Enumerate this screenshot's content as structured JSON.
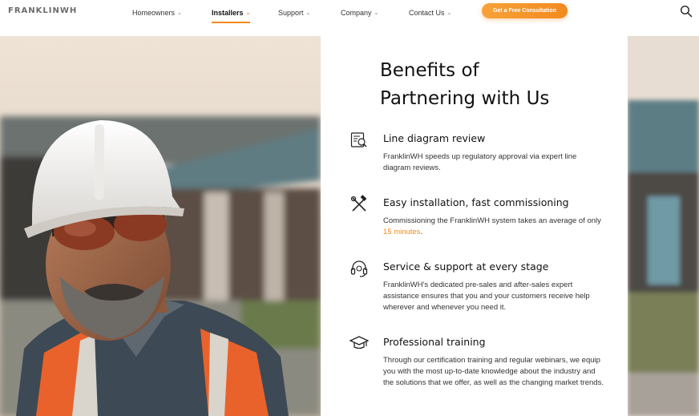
{
  "brand": {
    "logo_text": "FRANKLINWH",
    "accent": "#f08a1c"
  },
  "nav": {
    "items": [
      {
        "label": "Homeowners",
        "active": false
      },
      {
        "label": "Installers",
        "active": true
      },
      {
        "label": "Support",
        "active": false
      },
      {
        "label": "Company",
        "active": false
      },
      {
        "label": "Contact Us",
        "active": false
      }
    ],
    "cta_label": "Get a Free Consultation",
    "search_icon": "search-icon"
  },
  "section": {
    "heading_line1": "Benefits of",
    "heading_line2": "Partnering with Us",
    "items": [
      {
        "icon": "blueprint-icon",
        "title": "Line diagram review",
        "desc": "FranklinWH speeds up regulatory approval via expert line diagram reviews."
      },
      {
        "icon": "tools-icon",
        "title": "Easy installation, fast commissioning",
        "desc_prefix": "Commissioning the FranklinWH system takes an average of only",
        "desc_highlight": "15 minutes",
        "desc_suffix": "."
      },
      {
        "icon": "headset-icon",
        "title": "Service & support at every stage",
        "desc": "FranklinWH's dedicated pre-sales and after-sales expert assistance ensures that you and your customers receive help wherever and whenever you need it."
      },
      {
        "icon": "graduation-cap-icon",
        "title": "Professional training",
        "desc": "Through our certification training and regular webinars, we equip you with the most up-to-date knowledge about the industry and the solutions that we offer, as well as the changing market trends."
      }
    ]
  }
}
